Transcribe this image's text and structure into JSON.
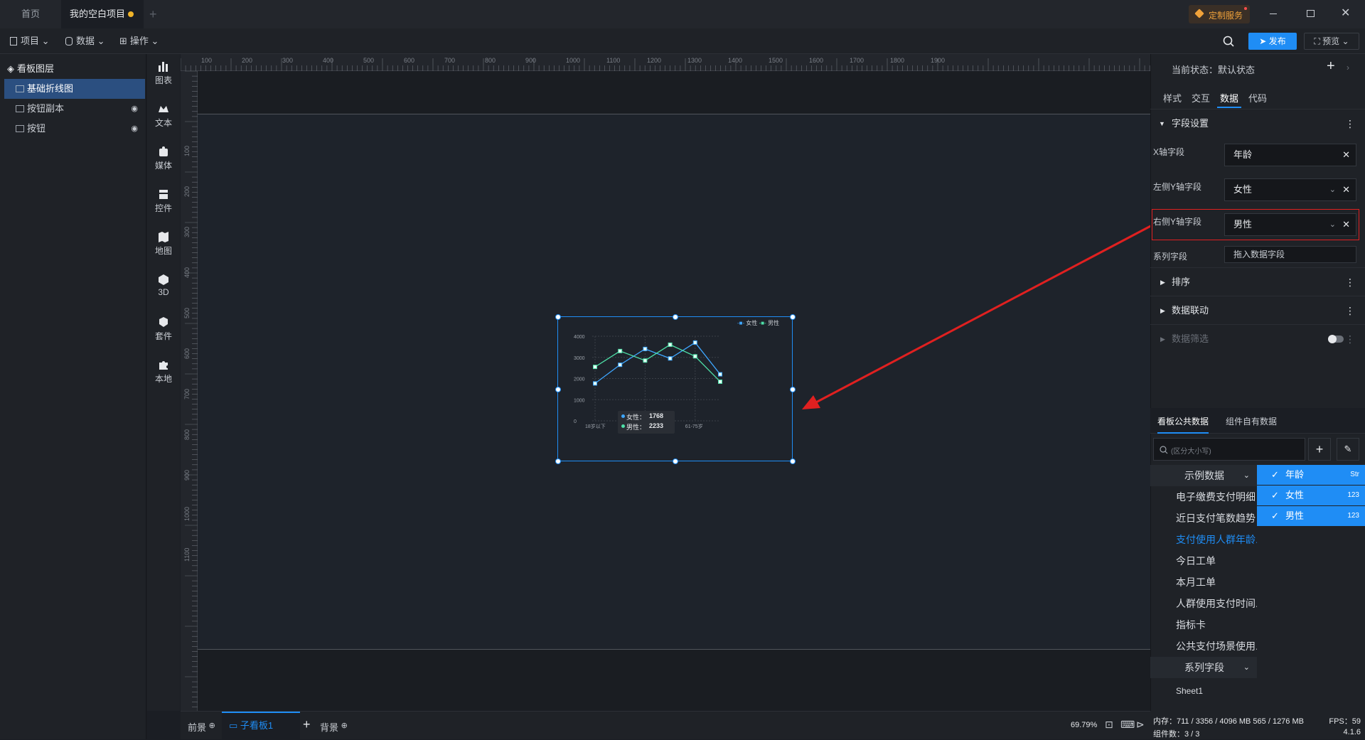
{
  "tabs": [
    {
      "label": "首页"
    },
    {
      "label": "我的空白项目"
    }
  ],
  "window": {
    "custom_service": "定制服务"
  },
  "menu": {
    "project": "项目",
    "data": "数据",
    "ops": "操作",
    "publish": "发布",
    "preview": "预览"
  },
  "layers": {
    "title": "看板图层",
    "items": [
      {
        "label": "基础折线图"
      },
      {
        "label": "按钮副本"
      },
      {
        "label": "按钮"
      }
    ]
  },
  "tools": [
    {
      "label": "图表",
      "icon": "bar-chart-icon"
    },
    {
      "label": "文本",
      "icon": "text-icon"
    },
    {
      "label": "媒体",
      "icon": "media-icon"
    },
    {
      "label": "控件",
      "icon": "widget-icon"
    },
    {
      "label": "地图",
      "icon": "map-icon"
    },
    {
      "label": "3D",
      "icon": "cube-icon"
    },
    {
      "label": "套件",
      "icon": "kit-icon"
    },
    {
      "label": "本地",
      "icon": "puzzle-icon"
    }
  ],
  "ruler": {
    "top": [
      "100",
      "200",
      "300",
      "400",
      "500",
      "600",
      "700",
      "800",
      "900",
      "1000",
      "1100",
      "1200",
      "1300",
      "1400",
      "1500",
      "1600",
      "1700",
      "1800",
      "1900"
    ],
    "left": [
      "100",
      "200",
      "300",
      "400",
      "500",
      "600",
      "700",
      "800",
      "900",
      "1000",
      "1100"
    ]
  },
  "chart_data": {
    "type": "line",
    "categories": [
      "18岁以下",
      "",
      "31-45岁",
      "",
      "61-75岁",
      ""
    ],
    "x_tick_labels": [
      "18岁以下",
      "31-45岁",
      "61-75岁"
    ],
    "ylim": [
      0,
      4000
    ],
    "y_ticks": [
      "4000",
      "3000",
      "2000",
      "1000",
      "0"
    ],
    "series": [
      {
        "name": "女性",
        "color": "#3ea6ff",
        "values": [
          1768,
          2650,
          3400,
          2950,
          3700,
          2200
        ]
      },
      {
        "name": "男性",
        "color": "#4ee0a8",
        "values": [
          2550,
          3300,
          2850,
          3600,
          3050,
          1850
        ]
      }
    ],
    "tooltip": {
      "female_label": "女性：",
      "female_value": "1768",
      "male_label": "男性：",
      "male_value": "2233"
    },
    "legend": "top-right",
    "grid": true
  },
  "bottom": {
    "foreground": "前景",
    "board": "子看板1",
    "background": "背景",
    "zoom": "69.79%"
  },
  "right": {
    "state_label": "当前状态：",
    "state_value": "默认状态",
    "tabs": [
      "样式",
      "交互",
      "数据",
      "代码"
    ],
    "field_section": "字段设置",
    "x_label": "X轴字段",
    "x_value": "年龄",
    "ly_label": "左侧Y轴字段",
    "ly_value": "女性",
    "ry_label": "右侧Y轴字段",
    "ry_value": "男性",
    "series_label": "系列字段",
    "series_placeholder": "拖入数据字段",
    "sort": "排序",
    "linkage": "数据联动",
    "filter": "数据筛选",
    "data_tabs": [
      "看板公共数据",
      "组件自有数据"
    ],
    "search_placeholder": "(区分大小写)",
    "datasets": [
      "示例数据",
      "电子缴费支付明细",
      "近日支付笔数趋势",
      "支付使用人群年龄...",
      "今日工单",
      "本月工单",
      "人群使用支付时间...",
      "指标卡",
      "公共支付场景使用...",
      "系列字段",
      "Sheet1"
    ],
    "fields": [
      {
        "name": "年龄",
        "type": "Str"
      },
      {
        "name": "女性",
        "type": "123"
      },
      {
        "name": "男性",
        "type": "123"
      }
    ],
    "accent": "#1f8df5"
  },
  "status": {
    "mem": "内存：711 / 3356 / 4096 MB  565 / 1276 MB",
    "fps": "FPS：59",
    "count": "组件数：3 / 3",
    "version": "4.1.6"
  }
}
